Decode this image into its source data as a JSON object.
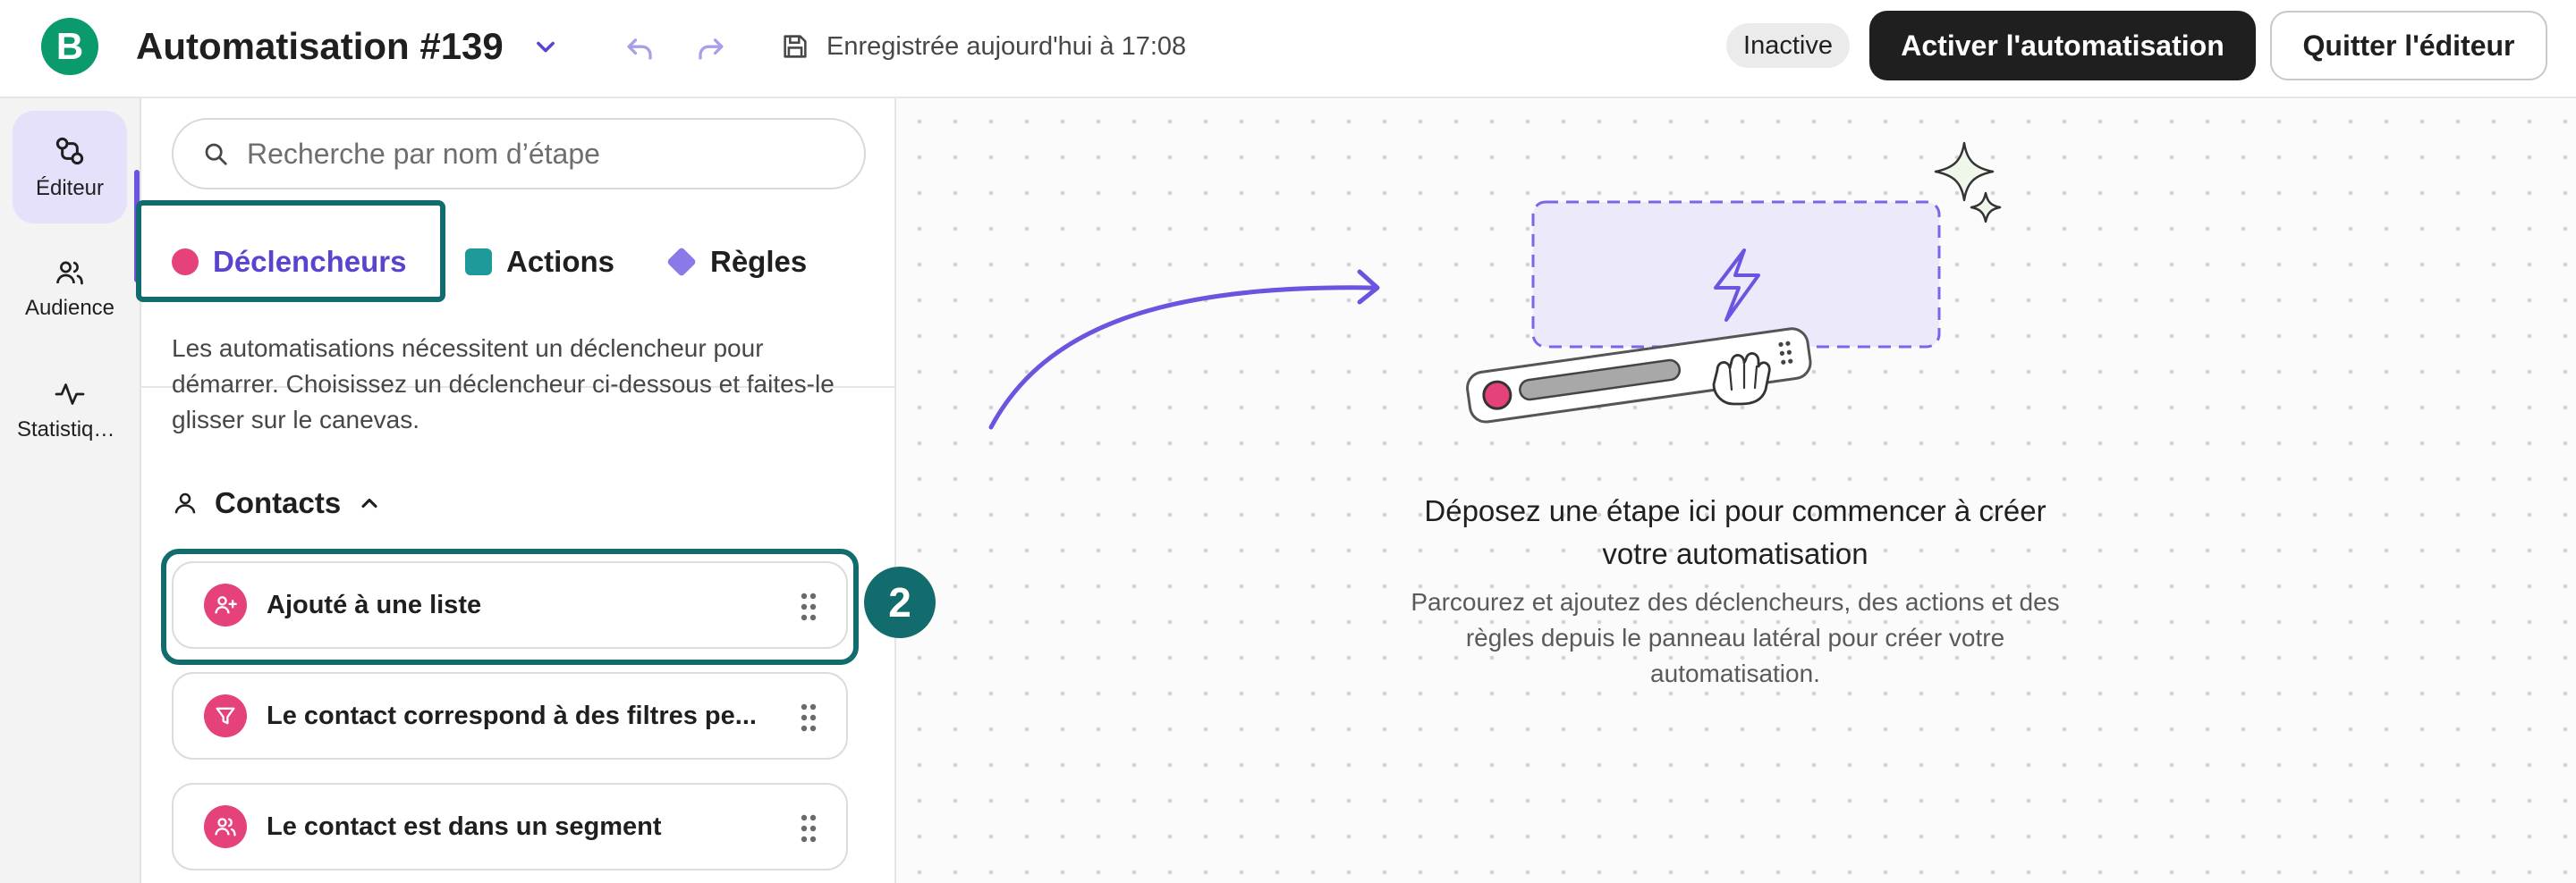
{
  "header": {
    "logo_letter": "B",
    "title": "Automatisation #139",
    "save_status": "Enregistrée aujourd'hui à 17:08",
    "status_badge": "Inactive",
    "activate_button": "Activer l'automatisation",
    "quit_button": "Quitter l'éditeur",
    "icons": [
      "chevron-down-icon",
      "undo-icon",
      "redo-icon",
      "save-icon"
    ]
  },
  "rail": {
    "items": [
      {
        "label": "Éditeur",
        "icon": "editor-icon",
        "active": true
      },
      {
        "label": "Audience",
        "icon": "audience-icon",
        "active": false
      },
      {
        "label": "Statistiques",
        "icon": "statistics-icon",
        "active": false
      }
    ]
  },
  "panel": {
    "search_placeholder": "Recherche par nom d’étape",
    "tabs": [
      {
        "label": "Déclencheurs",
        "active": true
      },
      {
        "label": "Actions",
        "active": false
      },
      {
        "label": "Règles",
        "active": false
      }
    ],
    "description": "Les automatisations nécessitent un déclencheur pour démarrer. Choisissez un déclencheur ci-dessous et faites-le glisser sur le canevas.",
    "group_title": "Contacts",
    "items": [
      {
        "label": "Ajouté à une liste",
        "icon": "add-user-icon"
      },
      {
        "label": "Le contact correspond à des filtres pe...",
        "icon": "filter-icon"
      },
      {
        "label": "Le contact est dans un segment",
        "icon": "segment-icon"
      }
    ],
    "step_badge": "2"
  },
  "canvas": {
    "empty_title": "Déposez une étape ici pour commencer à créer votre automatisation",
    "empty_description": "Parcourez et ajoutez des déclencheurs, des actions et des règles depuis le panneau latéral pour créer votre automatisation."
  },
  "colors": {
    "brand": "#0b996e",
    "accent_purple": "#6b54e0",
    "trigger_pink": "#e5427b",
    "action_teal": "#1f9a9a",
    "rule_purple": "#8a7ae8",
    "highlight_teal": "#126c6d"
  }
}
